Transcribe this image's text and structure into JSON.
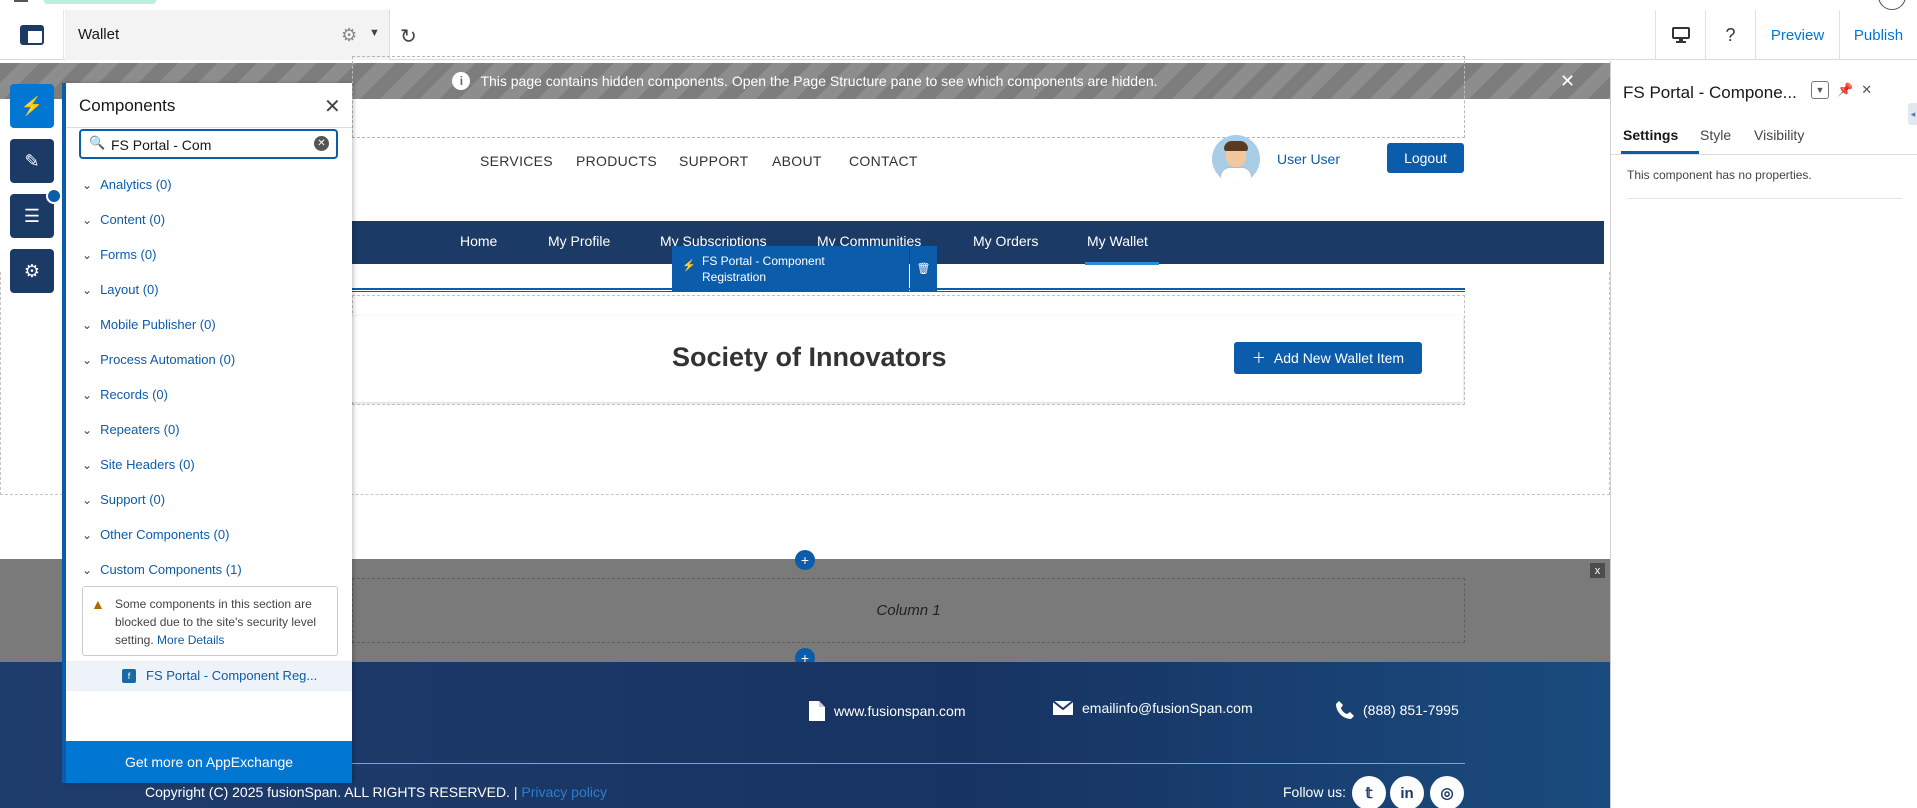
{
  "topbar": {
    "page_name": "Wallet",
    "preview": "Preview",
    "publish": "Publish",
    "help": "?"
  },
  "notice": {
    "text": "This page contains hidden components. Open the Page Structure pane to see which components are hidden."
  },
  "site_header": {
    "nav": [
      "SERVICES",
      "PRODUCTS",
      "SUPPORT",
      "ABOUT",
      "CONTACT"
    ],
    "user_name": "User User",
    "logout": "Logout"
  },
  "subnav": {
    "items": [
      "Home",
      "My Profile",
      "My Subscriptions",
      "My Communities",
      "My Orders",
      "My Wallet"
    ],
    "active": "My Wallet"
  },
  "selected_component": {
    "label_line1": "FS Portal - Component",
    "label_line2": "Registration"
  },
  "main": {
    "title": "Society of Innovators",
    "add_button": "Add New Wallet Item"
  },
  "column_section": {
    "label": "Column 1",
    "close": "x"
  },
  "footer": {
    "website": "www.fusionspan.com",
    "email": "emailinfo@fusionSpan.com",
    "phone": "(888) 851-7995",
    "copyright": "Copyright (C) 2025 fusionSpan. ALL RIGHTS RESERVED. |",
    "privacy": "Privacy policy",
    "follow": "Follow us:"
  },
  "components_panel": {
    "title": "Components",
    "search_value": "FS Portal - Com",
    "categories": [
      "Analytics (0)",
      "Content (0)",
      "Forms (0)",
      "Layout (0)",
      "Mobile Publisher (0)",
      "Process Automation (0)",
      "Records (0)",
      "Repeaters (0)",
      "Site Headers (0)",
      "Support (0)",
      "Other Components (0)",
      "Custom Components (1)"
    ],
    "warning_text": "Some components in this section are blocked due to the site's security level setting.",
    "warning_link": "More Details",
    "component_item": "FS Portal - Component Reg...",
    "appexchange": "Get more on AppExchange"
  },
  "properties_panel": {
    "title": "FS Portal - Compone...",
    "tabs": [
      "Settings",
      "Style",
      "Visibility"
    ],
    "active_tab": "Settings",
    "message": "This component has no properties."
  },
  "colors": {
    "brand_blue": "#0b5cab",
    "nav_navy": "#1b3a66",
    "appexchange_blue": "#0176d3"
  }
}
